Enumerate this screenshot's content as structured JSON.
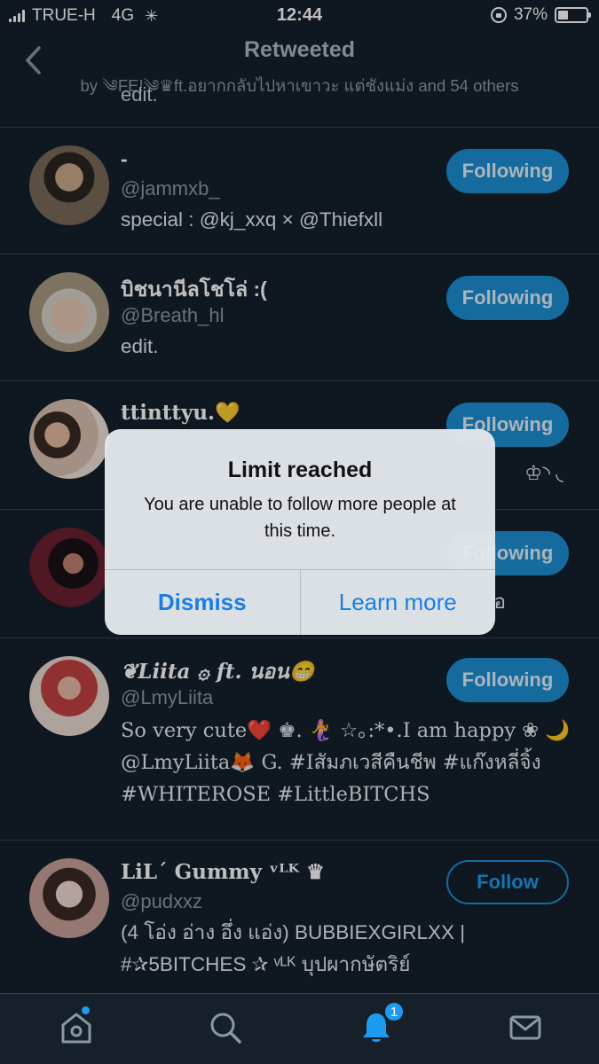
{
  "status_bar": {
    "carrier": "TRUE-H",
    "network": "4G",
    "time": "12:44",
    "battery": "37%",
    "battery_level": 0.37
  },
  "header": {
    "title": "Retweeted",
    "subtitle": "by ༄FE!༄♛ft.อยากกลับไปหาเขาวะ แต่ชังแม่ง and 54 others"
  },
  "list": {
    "top_stub_text": "edit.",
    "users": [
      {
        "name": "-",
        "handle": "@jammxb_",
        "bio": "special : @kj_xxq × @Thiefxll",
        "button": "Following"
      },
      {
        "name": "บิชนานีลโชโล่ :(",
        "handle": "@Breath_hl",
        "bio": "edit.",
        "button": "Following"
      },
      {
        "name": "ttinttyu.💛",
        "handle": "",
        "bio": "♔◝ ◟",
        "button": "Following"
      },
      {
        "name": "",
        "handle": "",
        "bio": "อ",
        "button": "Following"
      },
      {
        "name": "❦Liita ۞ ft. นอน😁",
        "handle": "@LmyLiita",
        "bio": "So very cute❤️ ♚. 🧜‍♀️ ☆｡:*•.I am happy ❀ 🌙@LmyLiita🦊 G. #Iสัมภเวสีคืนชีพ #แก๊งหลี่จิ้ง #WHITEROSE #LittleBITCHS",
        "button": "Following"
      },
      {
        "name": "LiL´ Gummy ᵛᴸᴷ ♛",
        "handle": "@pudxxz",
        "bio": "(4 โอ่ง อ่าง อึ่ง แอ่ง) BUBBIEXGIRLXX | #✰5BITCHES ✰ ᵛᴸᴷ บุปผากษัตริย์",
        "button": "Follow"
      }
    ]
  },
  "dialog": {
    "title": "Limit reached",
    "message": "You are unable to follow more people at this time.",
    "dismiss": "Dismiss",
    "learn_more": "Learn more"
  },
  "tabbar": {
    "notifications_badge": "1"
  },
  "colors": {
    "background": "#15202b",
    "accent": "#1d9bf0",
    "divider": "#38444d"
  }
}
